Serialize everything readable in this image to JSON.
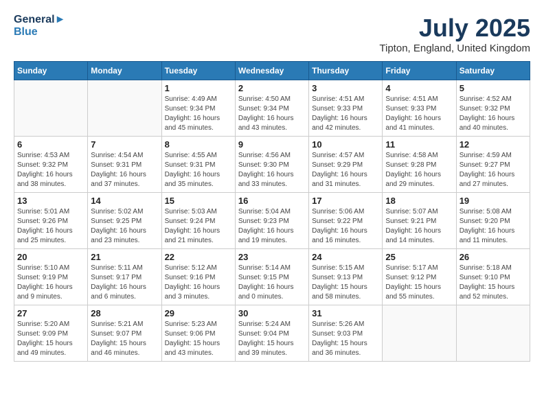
{
  "logo": {
    "line1": "General",
    "line2": "Blue"
  },
  "title": "July 2025",
  "location": "Tipton, England, United Kingdom",
  "days_header": [
    "Sunday",
    "Monday",
    "Tuesday",
    "Wednesday",
    "Thursday",
    "Friday",
    "Saturday"
  ],
  "weeks": [
    [
      {
        "day": "",
        "detail": ""
      },
      {
        "day": "",
        "detail": ""
      },
      {
        "day": "1",
        "detail": "Sunrise: 4:49 AM\nSunset: 9:34 PM\nDaylight: 16 hours\nand 45 minutes."
      },
      {
        "day": "2",
        "detail": "Sunrise: 4:50 AM\nSunset: 9:34 PM\nDaylight: 16 hours\nand 43 minutes."
      },
      {
        "day": "3",
        "detail": "Sunrise: 4:51 AM\nSunset: 9:33 PM\nDaylight: 16 hours\nand 42 minutes."
      },
      {
        "day": "4",
        "detail": "Sunrise: 4:51 AM\nSunset: 9:33 PM\nDaylight: 16 hours\nand 41 minutes."
      },
      {
        "day": "5",
        "detail": "Sunrise: 4:52 AM\nSunset: 9:32 PM\nDaylight: 16 hours\nand 40 minutes."
      }
    ],
    [
      {
        "day": "6",
        "detail": "Sunrise: 4:53 AM\nSunset: 9:32 PM\nDaylight: 16 hours\nand 38 minutes."
      },
      {
        "day": "7",
        "detail": "Sunrise: 4:54 AM\nSunset: 9:31 PM\nDaylight: 16 hours\nand 37 minutes."
      },
      {
        "day": "8",
        "detail": "Sunrise: 4:55 AM\nSunset: 9:31 PM\nDaylight: 16 hours\nand 35 minutes."
      },
      {
        "day": "9",
        "detail": "Sunrise: 4:56 AM\nSunset: 9:30 PM\nDaylight: 16 hours\nand 33 minutes."
      },
      {
        "day": "10",
        "detail": "Sunrise: 4:57 AM\nSunset: 9:29 PM\nDaylight: 16 hours\nand 31 minutes."
      },
      {
        "day": "11",
        "detail": "Sunrise: 4:58 AM\nSunset: 9:28 PM\nDaylight: 16 hours\nand 29 minutes."
      },
      {
        "day": "12",
        "detail": "Sunrise: 4:59 AM\nSunset: 9:27 PM\nDaylight: 16 hours\nand 27 minutes."
      }
    ],
    [
      {
        "day": "13",
        "detail": "Sunrise: 5:01 AM\nSunset: 9:26 PM\nDaylight: 16 hours\nand 25 minutes."
      },
      {
        "day": "14",
        "detail": "Sunrise: 5:02 AM\nSunset: 9:25 PM\nDaylight: 16 hours\nand 23 minutes."
      },
      {
        "day": "15",
        "detail": "Sunrise: 5:03 AM\nSunset: 9:24 PM\nDaylight: 16 hours\nand 21 minutes."
      },
      {
        "day": "16",
        "detail": "Sunrise: 5:04 AM\nSunset: 9:23 PM\nDaylight: 16 hours\nand 19 minutes."
      },
      {
        "day": "17",
        "detail": "Sunrise: 5:06 AM\nSunset: 9:22 PM\nDaylight: 16 hours\nand 16 minutes."
      },
      {
        "day": "18",
        "detail": "Sunrise: 5:07 AM\nSunset: 9:21 PM\nDaylight: 16 hours\nand 14 minutes."
      },
      {
        "day": "19",
        "detail": "Sunrise: 5:08 AM\nSunset: 9:20 PM\nDaylight: 16 hours\nand 11 minutes."
      }
    ],
    [
      {
        "day": "20",
        "detail": "Sunrise: 5:10 AM\nSunset: 9:19 PM\nDaylight: 16 hours\nand 9 minutes."
      },
      {
        "day": "21",
        "detail": "Sunrise: 5:11 AM\nSunset: 9:17 PM\nDaylight: 16 hours\nand 6 minutes."
      },
      {
        "day": "22",
        "detail": "Sunrise: 5:12 AM\nSunset: 9:16 PM\nDaylight: 16 hours\nand 3 minutes."
      },
      {
        "day": "23",
        "detail": "Sunrise: 5:14 AM\nSunset: 9:15 PM\nDaylight: 16 hours\nand 0 minutes."
      },
      {
        "day": "24",
        "detail": "Sunrise: 5:15 AM\nSunset: 9:13 PM\nDaylight: 15 hours\nand 58 minutes."
      },
      {
        "day": "25",
        "detail": "Sunrise: 5:17 AM\nSunset: 9:12 PM\nDaylight: 15 hours\nand 55 minutes."
      },
      {
        "day": "26",
        "detail": "Sunrise: 5:18 AM\nSunset: 9:10 PM\nDaylight: 15 hours\nand 52 minutes."
      }
    ],
    [
      {
        "day": "27",
        "detail": "Sunrise: 5:20 AM\nSunset: 9:09 PM\nDaylight: 15 hours\nand 49 minutes."
      },
      {
        "day": "28",
        "detail": "Sunrise: 5:21 AM\nSunset: 9:07 PM\nDaylight: 15 hours\nand 46 minutes."
      },
      {
        "day": "29",
        "detail": "Sunrise: 5:23 AM\nSunset: 9:06 PM\nDaylight: 15 hours\nand 43 minutes."
      },
      {
        "day": "30",
        "detail": "Sunrise: 5:24 AM\nSunset: 9:04 PM\nDaylight: 15 hours\nand 39 minutes."
      },
      {
        "day": "31",
        "detail": "Sunrise: 5:26 AM\nSunset: 9:03 PM\nDaylight: 15 hours\nand 36 minutes."
      },
      {
        "day": "",
        "detail": ""
      },
      {
        "day": "",
        "detail": ""
      }
    ]
  ]
}
